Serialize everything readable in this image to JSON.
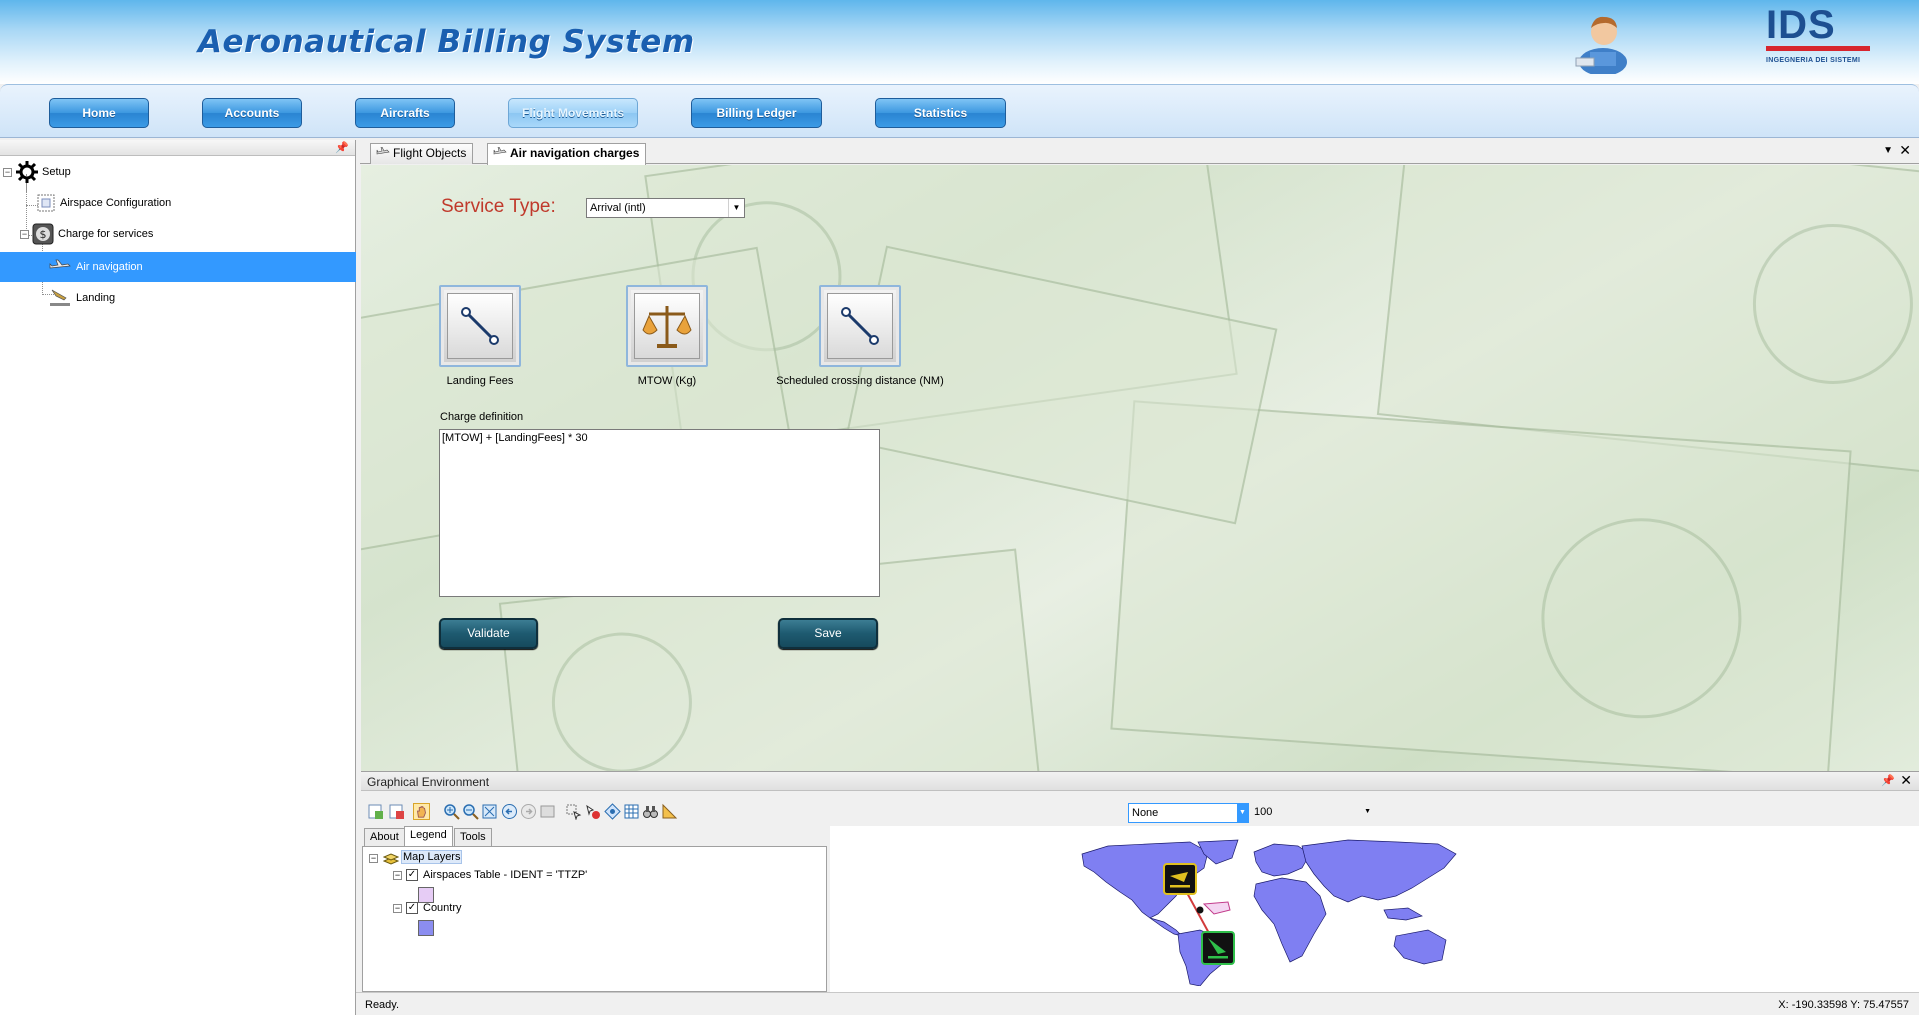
{
  "header": {
    "app_title": "Aeronautical Billing System",
    "logo": {
      "mark": "IDS",
      "subtitle": "INGEGNERIA DEI SISTEMI"
    },
    "avatar_icon": "user-avatar-icon"
  },
  "nav": {
    "items": [
      {
        "label": "Home"
      },
      {
        "label": "Accounts"
      },
      {
        "label": "Aircrafts"
      },
      {
        "label": "Flight Movements",
        "active": true
      },
      {
        "label": "Billing Ledger"
      },
      {
        "label": "Statistics"
      }
    ]
  },
  "tree": {
    "items": [
      {
        "label": "Setup",
        "icon": "gear-icon"
      },
      {
        "label": "Airspace Configuration",
        "icon": "grid-icon"
      },
      {
        "label": "Charge for services",
        "icon": "money-icon"
      },
      {
        "label": "Air navigation",
        "icon": "plane-icon",
        "selected": true
      },
      {
        "label": "Landing",
        "icon": "landing-icon"
      }
    ]
  },
  "tabs": {
    "items": [
      {
        "label": "Flight Objects"
      },
      {
        "label": "Air navigation charges",
        "active": true
      }
    ]
  },
  "form": {
    "service_type_label": "Service Type:",
    "service_type_value": "Arrival (intl)",
    "params": [
      {
        "label": "Landing Fees",
        "icon": "line-icon"
      },
      {
        "label": "MTOW (Kg)",
        "icon": "scales-icon"
      },
      {
        "label": "Scheduled crossing distance (NM)",
        "icon": "line-icon"
      }
    ],
    "charge_def_label": "Charge definition",
    "charge_def_value": "[MTOW] + [LandingFees] * 30",
    "validate_label": "Validate",
    "save_label": "Save"
  },
  "graphical_env": {
    "title": "Graphical Environment",
    "zoom_value": "None",
    "scale_value": "100",
    "tabs": [
      {
        "label": "About"
      },
      {
        "label": "Legend",
        "active": true
      },
      {
        "label": "Tools"
      }
    ],
    "legend": {
      "root": "Map Layers",
      "layers": [
        {
          "label": "Airspaces Table - IDENT = 'TTZP'",
          "checked": true,
          "color": "#e6ccf5"
        },
        {
          "label": "Country",
          "checked": true,
          "color": "#8b8df0"
        }
      ]
    },
    "map_color": "#7f7ff2"
  },
  "status": {
    "text": "Ready.",
    "coords": "X: -190.33598  Y: 75.47557"
  }
}
